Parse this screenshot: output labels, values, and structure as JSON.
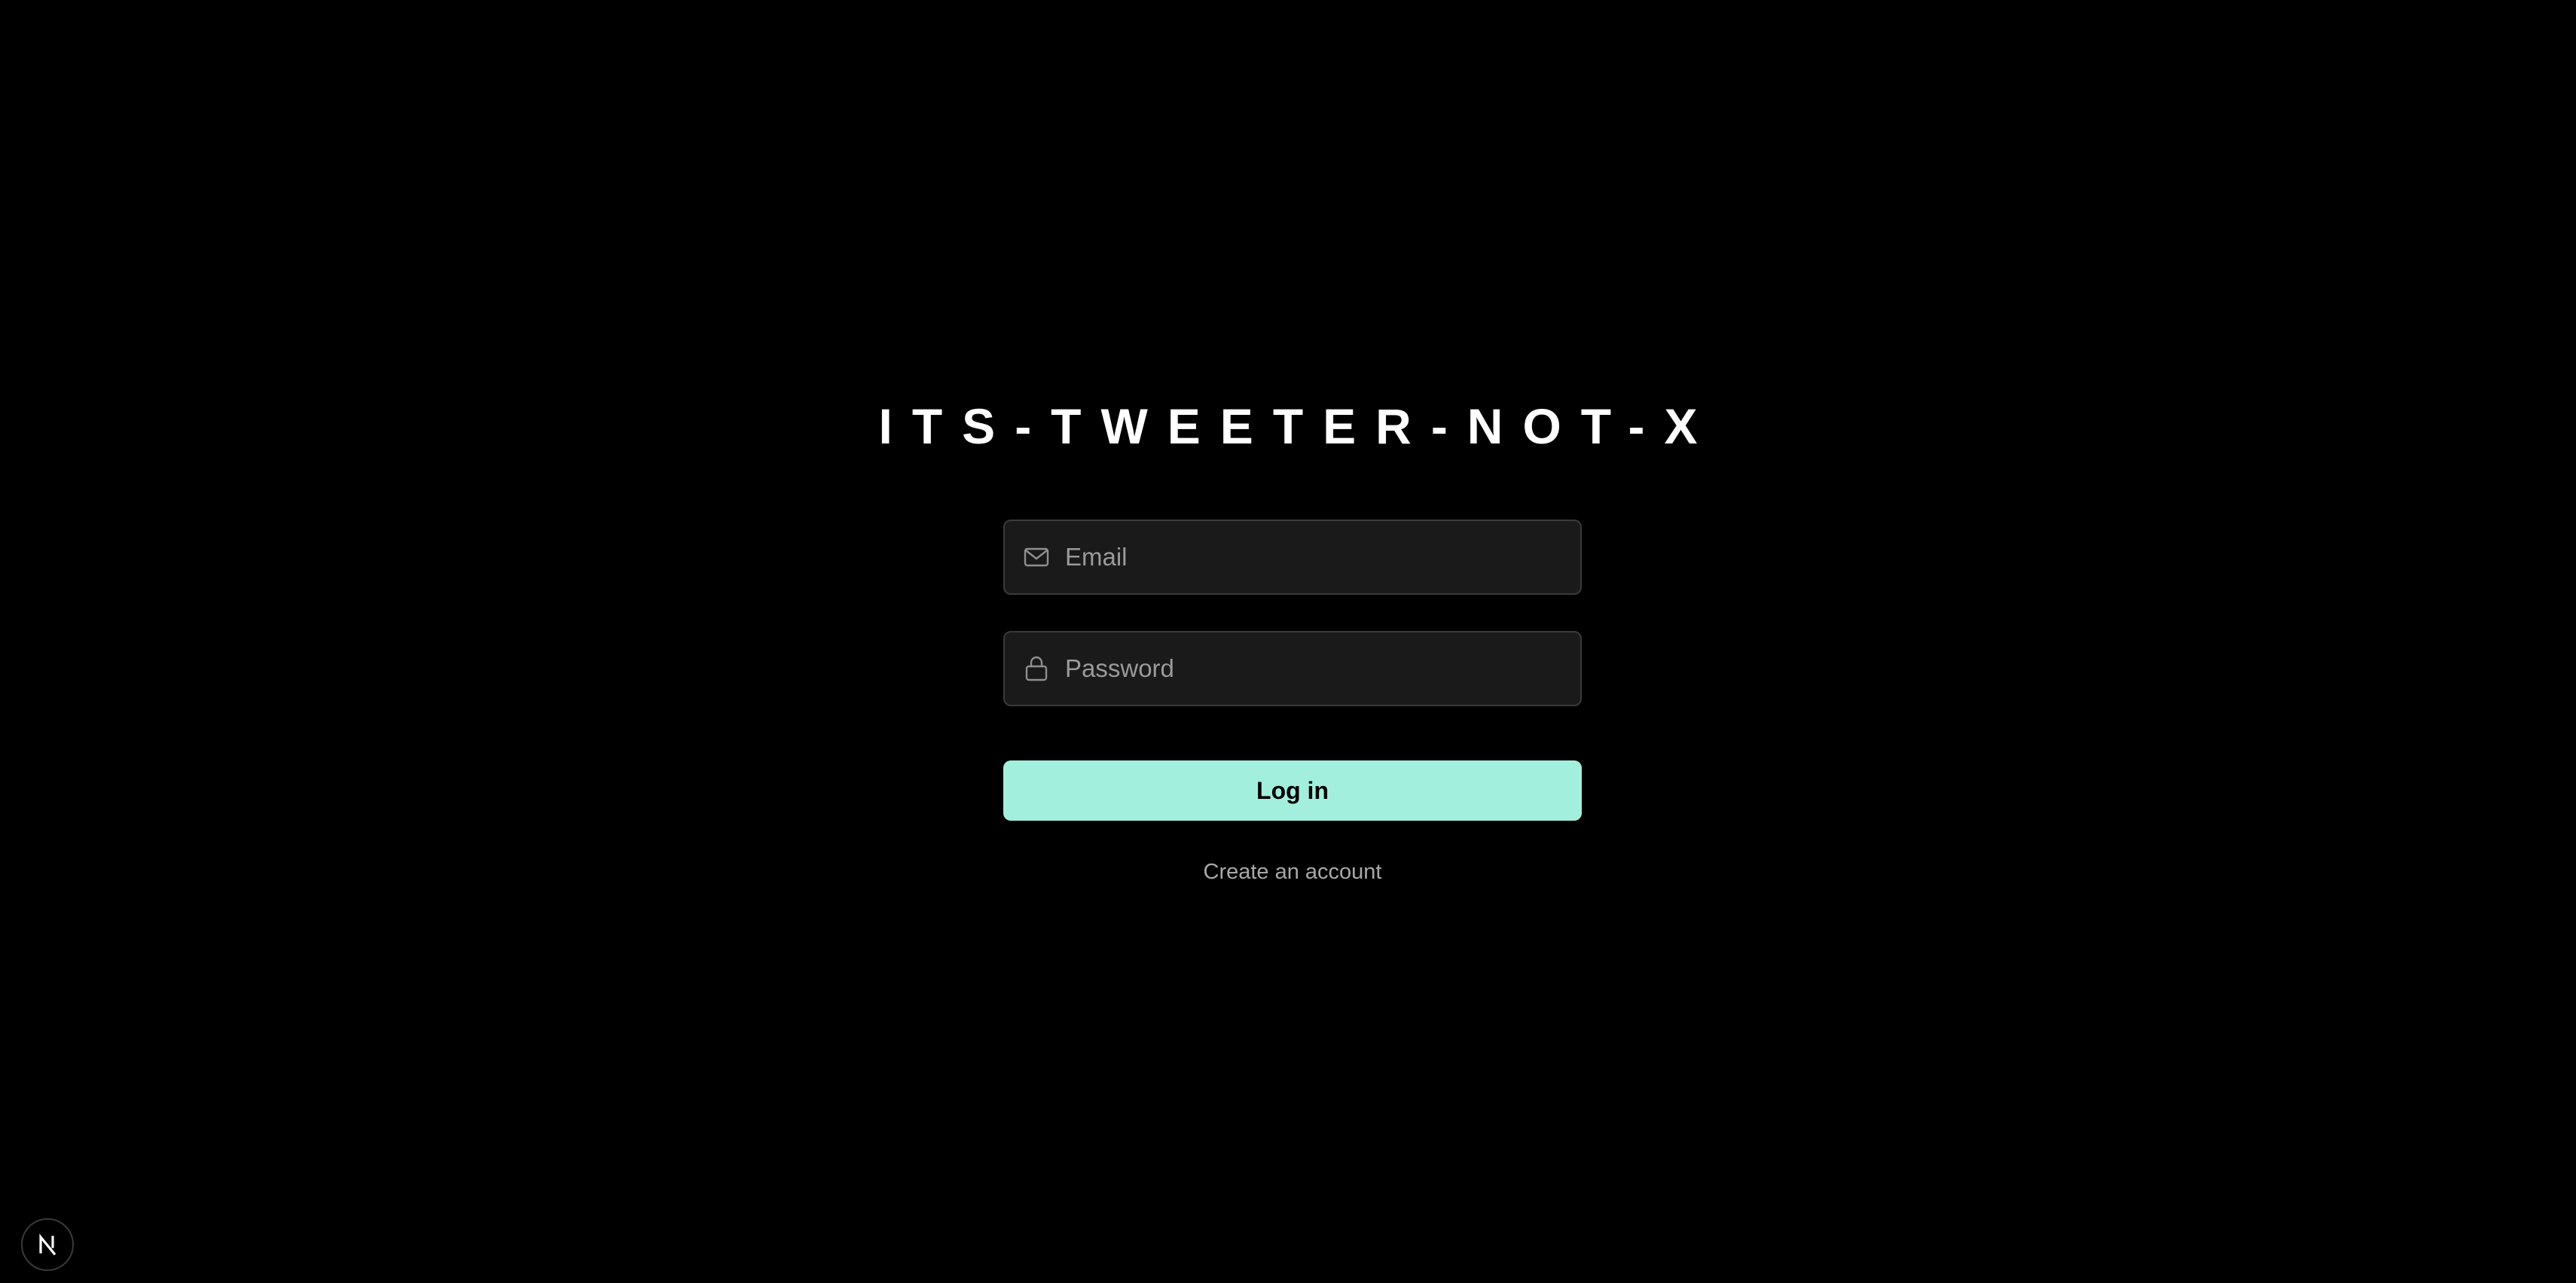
{
  "app": {
    "title": "ITS-TWEETER-NOT-X"
  },
  "login_form": {
    "email": {
      "placeholder": "Email",
      "value": "",
      "icon": "mail-icon"
    },
    "password": {
      "placeholder": "Password",
      "value": "",
      "icon": "lock-icon"
    },
    "login_label": "Log in",
    "create_account_label": "Create an account"
  },
  "dev_badge": {
    "label": "N",
    "icon": "nextjs-logo-icon"
  },
  "colors": {
    "background": "#000000",
    "input_background": "#1a1a1a",
    "input_border": "#3a3a3a",
    "accent": "#a2efdd",
    "muted_text": "#a8a8a8"
  }
}
